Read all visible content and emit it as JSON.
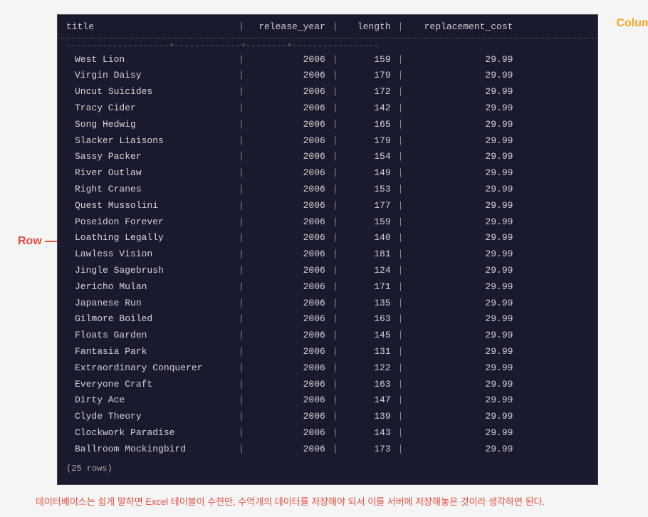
{
  "labels": {
    "column": "Column",
    "row": "Row"
  },
  "table": {
    "headers": [
      "title",
      "release_year",
      "length",
      "replacement_cost"
    ],
    "rows": [
      {
        "title": "West Lion",
        "release_year": "2006",
        "length": "159",
        "replacement_cost": "29.99"
      },
      {
        "title": "Virgin Daisy",
        "release_year": "2006",
        "length": "179",
        "replacement_cost": "29.99"
      },
      {
        "title": "Uncut Suicides",
        "release_year": "2006",
        "length": "172",
        "replacement_cost": "29.99"
      },
      {
        "title": "Tracy Cider",
        "release_year": "2006",
        "length": "142",
        "replacement_cost": "29.99"
      },
      {
        "title": "Song Hedwig",
        "release_year": "2006",
        "length": "165",
        "replacement_cost": "29.99"
      },
      {
        "title": "Slacker Liaisons",
        "release_year": "2006",
        "length": "179",
        "replacement_cost": "29.99"
      },
      {
        "title": "Sassy Packer",
        "release_year": "2006",
        "length": "154",
        "replacement_cost": "29.99"
      },
      {
        "title": "River Outlaw",
        "release_year": "2006",
        "length": "149",
        "replacement_cost": "29.99"
      },
      {
        "title": "Right Cranes",
        "release_year": "2006",
        "length": "153",
        "replacement_cost": "29.99"
      },
      {
        "title": "Quest Mussolini",
        "release_year": "2006",
        "length": "177",
        "replacement_cost": "29.99"
      },
      {
        "title": "Poseidon Forever",
        "release_year": "2006",
        "length": "159",
        "replacement_cost": "29.99"
      },
      {
        "title": "Loathing Legally",
        "release_year": "2006",
        "length": "140",
        "replacement_cost": "29.99"
      },
      {
        "title": "Lawless Vision",
        "release_year": "2006",
        "length": "181",
        "replacement_cost": "29.99"
      },
      {
        "title": "Jingle Sagebrush",
        "release_year": "2006",
        "length": "124",
        "replacement_cost": "29.99"
      },
      {
        "title": "Jericho Mulan",
        "release_year": "2006",
        "length": "171",
        "replacement_cost": "29.99"
      },
      {
        "title": "Japanese Run",
        "release_year": "2006",
        "length": "135",
        "replacement_cost": "29.99"
      },
      {
        "title": "Gilmore Boiled",
        "release_year": "2006",
        "length": "163",
        "replacement_cost": "29.99"
      },
      {
        "title": "Floats Garden",
        "release_year": "2006",
        "length": "145",
        "replacement_cost": "29.99"
      },
      {
        "title": "Fantasia Park",
        "release_year": "2006",
        "length": "131",
        "replacement_cost": "29.99"
      },
      {
        "title": "Extraordinary Conquerer",
        "release_year": "2006",
        "length": "122",
        "replacement_cost": "29.99"
      },
      {
        "title": "Everyone Craft",
        "release_year": "2006",
        "length": "163",
        "replacement_cost": "29.99"
      },
      {
        "title": "Dirty Ace",
        "release_year": "2006",
        "length": "147",
        "replacement_cost": "29.99"
      },
      {
        "title": "Clyde Theory",
        "release_year": "2006",
        "length": "139",
        "replacement_cost": "29.99"
      },
      {
        "title": "Clockwork Paradise",
        "release_year": "2006",
        "length": "143",
        "replacement_cost": "29.99"
      },
      {
        "title": "Ballroom Mockingbird",
        "release_year": "2006",
        "length": "173",
        "replacement_cost": "29.99"
      }
    ],
    "row_count": "(25 rows)"
  },
  "bottom_text": "데이터베이스는 쉽게 말하면 Excel 테이블이 수천만, 수억개의 데이터를 저장해야 되서 이를 서버에 저장해놓은 것이라 생각하면 된다."
}
